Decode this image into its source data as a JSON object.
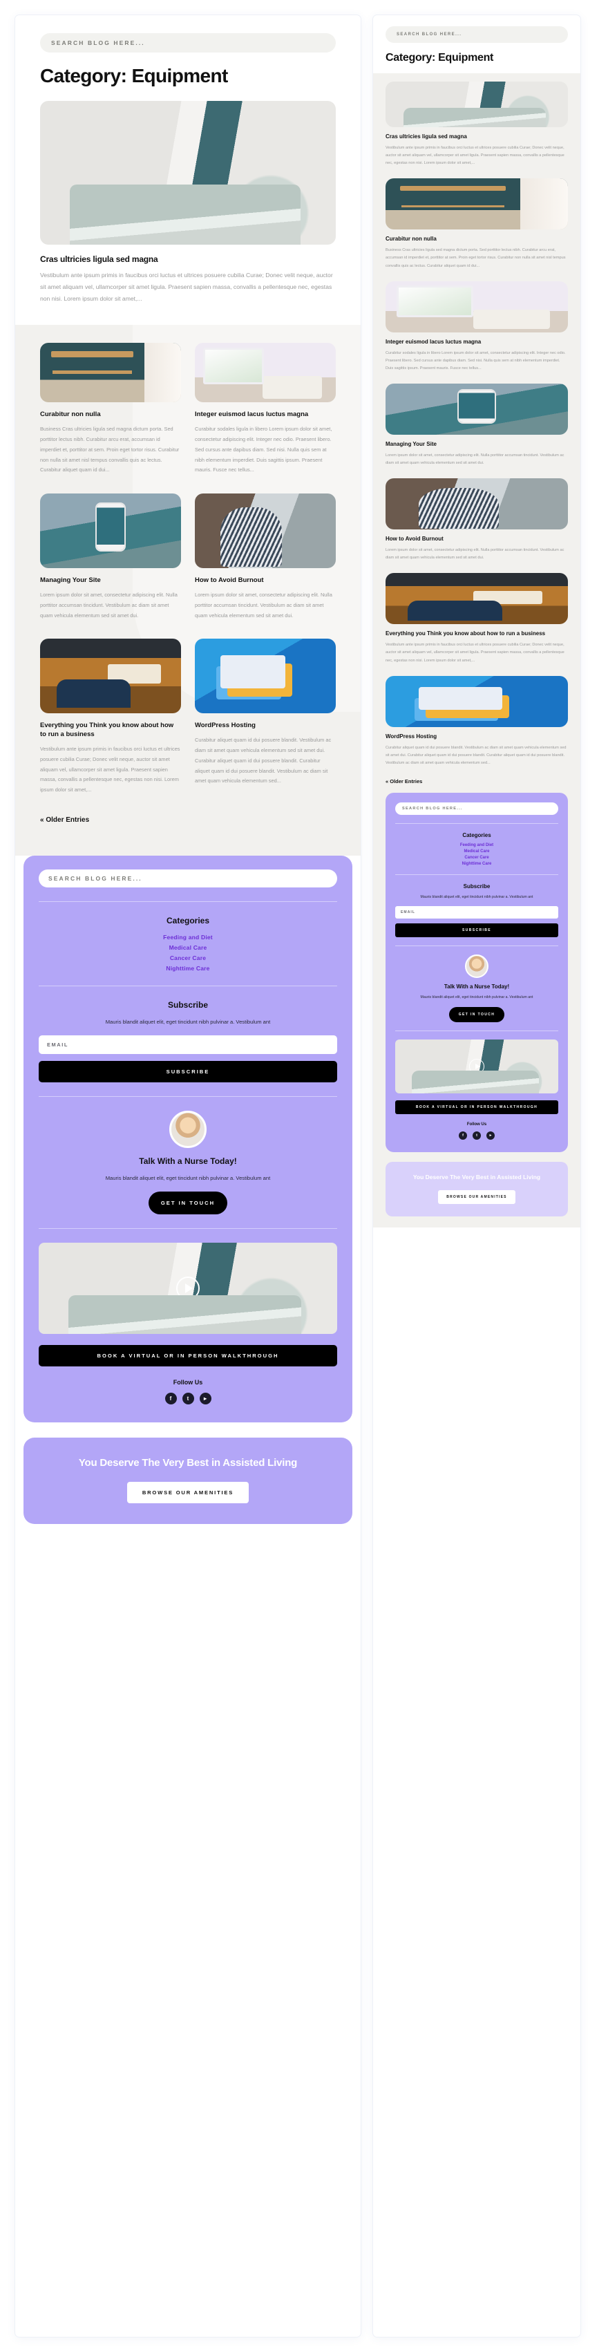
{
  "search": {
    "placeholder": "SEARCH BLOG HERE..."
  },
  "page": {
    "title": "Category: Equipment"
  },
  "featured": {
    "title": "Cras ultricies ligula sed magna",
    "excerpt": "Vestibulum ante ipsum primis in faucibus orci luctus et ultrices posuere cubilia Curae; Donec velit neque, auctor sit amet aliquam vel, ullamcorper sit amet ligula. Praesent sapien massa, convallis a pellentesque nec, egestas non nisi. Lorem ipsum dolor sit amet,...",
    "image": "sofa-terrarium-photo"
  },
  "posts": [
    {
      "title": "Curabitur non nulla",
      "excerpt": "Business Cras ultricies ligula sed magna dictum porta. Sed porttitor lectus nibh. Curabitur arcu erat, accumsan id imperdiet et, porttitor at sem. Proin eget tortor risus. Curabitur non nulla sit amet nisl tempus convallis quis ac lectus. Curabitur aliquet quam id dui...",
      "image": "teal-wall-shelf-photo"
    },
    {
      "title": "Integer euismod lacus luctus magna",
      "excerpt": "Curabitur sodales ligula in libero Lorem ipsum dolor sit amet, consectetur adipiscing elit. Integer nec odio. Praesent libero. Sed cursus ante dapibus diam. Sed nisi. Nulla quis sem at nibh elementum imperdiet. Duis sagittis ipsum. Praesent mauris. Fusce nec tellus...",
      "image": "bright-dining-room-photo"
    },
    {
      "title": "Managing Your Site",
      "excerpt": "Lorem ipsum dolor sit amet, consectetur adipiscing elit. Nulla porttitor accumsan tincidunt. Vestibulum ac diam sit amet quam vehicula elementum sed sit amet dui.",
      "image": "phone-mountain-lake-photo"
    },
    {
      "title": "How to Avoid Burnout",
      "excerpt": "Lorem ipsum dolor sit amet, consectetur adipiscing elit. Nulla porttitor accumsan tincidunt. Vestibulum ac diam sit amet quam vehicula elementum sed sit amet dui.",
      "image": "woman-by-window-photo"
    },
    {
      "title": "Everything you Think you know about how to run a business",
      "excerpt": "Vestibulum ante ipsum primis in faucibus orci luctus et ultrices posuere cubilia Curae; Donec velit neque, auctor sit amet aliquam vel, ullamcorper sit amet ligula. Praesent sapien massa, convallis a pellentesque nec, egestas non nisi. Lorem ipsum dolor sit amet,...",
      "image": "business-meeting-table-photo"
    },
    {
      "title": "WordPress Hosting",
      "excerpt": "Curabitur aliquet quam id dui posuere blandit. Vestibulum ac diam sit amet quam vehicula elementum sed sit amet dui. Curabitur aliquet quam id dui posuere blandit. Curabitur aliquet quam id dui posuere blandit. Vestibulum ac diam sit amet quam vehicula elementum sed...",
      "image": "wordpress-hosting-illustration"
    }
  ],
  "pagination": {
    "older": "« Older Entries"
  },
  "widget": {
    "categories_title": "Categories",
    "categories": [
      {
        "label": "Feeding and Diet"
      },
      {
        "label": "Medical Care"
      },
      {
        "label": "Cancer Care"
      },
      {
        "label": "Nighttime Care"
      }
    ],
    "subscribe_title": "Subscribe",
    "subscribe_desc": "Mauris blandit aliquet elit, eget tincidunt nibh pulvinar a. Vestibulum ant",
    "email_placeholder": "EMAIL",
    "subscribe_button": "SUBSCRIBE",
    "nurse_title": "Talk With a Nurse Today!",
    "nurse_desc": "Mauris blandit aliquet elit, eget tincidunt nibh pulvinar a. Vestibulum ant",
    "nurse_button": "GET IN TOUCH",
    "video_alt": "sofa-terrarium-video",
    "walkthrough_button": "BOOK A VIRTUAL OR IN PERSON WALKTHROUGH",
    "follow_title": "Follow Us",
    "socials": [
      {
        "name": "facebook-icon",
        "glyph": "f"
      },
      {
        "name": "twitter-icon",
        "glyph": "t"
      },
      {
        "name": "youtube-icon",
        "glyph": "▸"
      }
    ]
  },
  "cta": {
    "heading": "You Deserve The Very Best in Assisted Living",
    "button": "BROWSE OUR AMENITIES"
  },
  "colors": {
    "accent_purple": "#b3a6f7",
    "link_purple": "#6d2fd6",
    "surface_grey": "#f2f1ee",
    "black": "#000000"
  }
}
